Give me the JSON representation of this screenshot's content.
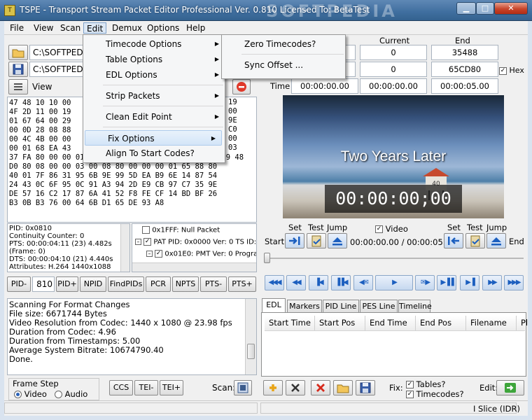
{
  "window": {
    "title": "TSPE - Transport Stream Packet Editor Professional Ver. 0.810 Licensed To: BetaTest",
    "watermark": "SOFTPEDIA"
  },
  "menubar": [
    "File",
    "View",
    "Scan",
    "Edit",
    "Demux",
    "Options",
    "Help"
  ],
  "edit_menu": {
    "items": [
      "Timecode Options",
      "Table Options",
      "EDL Options",
      "Strip Packets",
      "Clean Edit Point",
      "Fix Options",
      "Align To Start Codes?"
    ]
  },
  "timecode_submenu": {
    "items": [
      "Zero Timecodes?",
      "Sync Offset ..."
    ]
  },
  "toolbar": {
    "path_top": "C:\\SOFTPEDIA",
    "path_bottom": "C:\\SOFTPEDIA",
    "view_label": "View"
  },
  "hex": [
    "47 48 10 10 00",
    "4F 2D 11 00 19",
    "01 67 64 00 29",
    "00 0D 28 08 88",
    "00 4C 4B 00 00",
    "00 01 68 EA 43",
    "37 FA 80 00 00 01 06 05 FF FF EE DC 45 E9 BD E6 D9 48",
    "D0 80 08 00 00 03 00 08 80 00 00 00 01 65 88 80",
    "40 01 7F 86 31 95 6B 9E 99 5D EA B9 6E 14 87 54",
    "24 43 0C 6F 95 0C 91 A3 94 2D E9 CB 97 C7 35 9E",
    "DE 57 16 C2 17 87 6A 41 52 F8 FE CF 14 BD BF 26",
    "B3 0B B3 76 00 64 6B D1 65 DE 93 A8"
  ],
  "hex_tail": [
    "19",
    "00",
    "9E",
    "C0",
    "00",
    "03",
    "",
    "",
    "",
    "",
    "",
    ""
  ],
  "pid_info": [
    "PID: 0x0810",
    "Continuity Counter: 0",
    "PTS: 00:00:04:11 (23)  4.482s",
    "(Frame: 0)",
    "DTS: 00:00:04:10 (21)  4.440s",
    "Attributes: H.264 1440x1088"
  ],
  "tree": [
    "0x1FFF: Null Packet",
    "PAT PID: 0x0000 Ver: 0 TS ID:",
    "0x01E0: PMT Ver: 0 Progra"
  ],
  "pid_buttons": [
    "PID-",
    "810",
    "PID+",
    "NPID",
    "FindPIDs",
    "PCR",
    "NPTS",
    "PTS-",
    "PTS+"
  ],
  "log": [
    "Scanning For Format Changes",
    "File size: 6671744 Bytes",
    "Video Resolution from Codec: 1440 x 1080 @ 23.98 fps",
    "Duration from Codec: 4.96",
    "Duration from Timestamps: 5.00",
    "Average System Bitrate: 10674790.40",
    "Done."
  ],
  "frame_step": {
    "label": "Frame Step",
    "video": "Video",
    "audio": "Audio",
    "selected": "Video"
  },
  "bottom_buttons": [
    "CCS",
    "TEI-",
    "TEI+"
  ],
  "scan_label": "Scan:",
  "info": {
    "headers": [
      "Current",
      "End"
    ],
    "row1": {
      "current": "0",
      "end": "35488"
    },
    "row2": {
      "current": "0",
      "end": "65CD80"
    },
    "hex_label": "Hex",
    "hex_checked": true,
    "time_label": "Time",
    "time": {
      "start": "00:00:00.00",
      "current": "00:00:00.00",
      "end": "00:00:05.00"
    }
  },
  "video": {
    "caption": "Two Years Later",
    "timecode": "00:00:00;00"
  },
  "setpoint": {
    "labels": [
      "Set",
      "Test",
      "Jump"
    ],
    "start_label": "Start",
    "end_label": "End",
    "video_label": "Video",
    "video_checked": true,
    "position": "00:00:00.00 / 00:00:05.00"
  },
  "edl": {
    "tabs": [
      "EDL",
      "Markers",
      "PID Line",
      "PES Line",
      "Timeline"
    ],
    "active_tab": "EDL",
    "columns": [
      "Start Time",
      "Start Pos",
      "End Time",
      "End Pos",
      "Filename",
      "Pl"
    ],
    "fix_label": "Fix:",
    "tables_label": "Tables?",
    "timecodes_label": "Timecodes?",
    "tables_checked": true,
    "timecodes_checked": true,
    "edit_label": "Edit:"
  },
  "status": {
    "slice": "I Slice (IDR)"
  }
}
